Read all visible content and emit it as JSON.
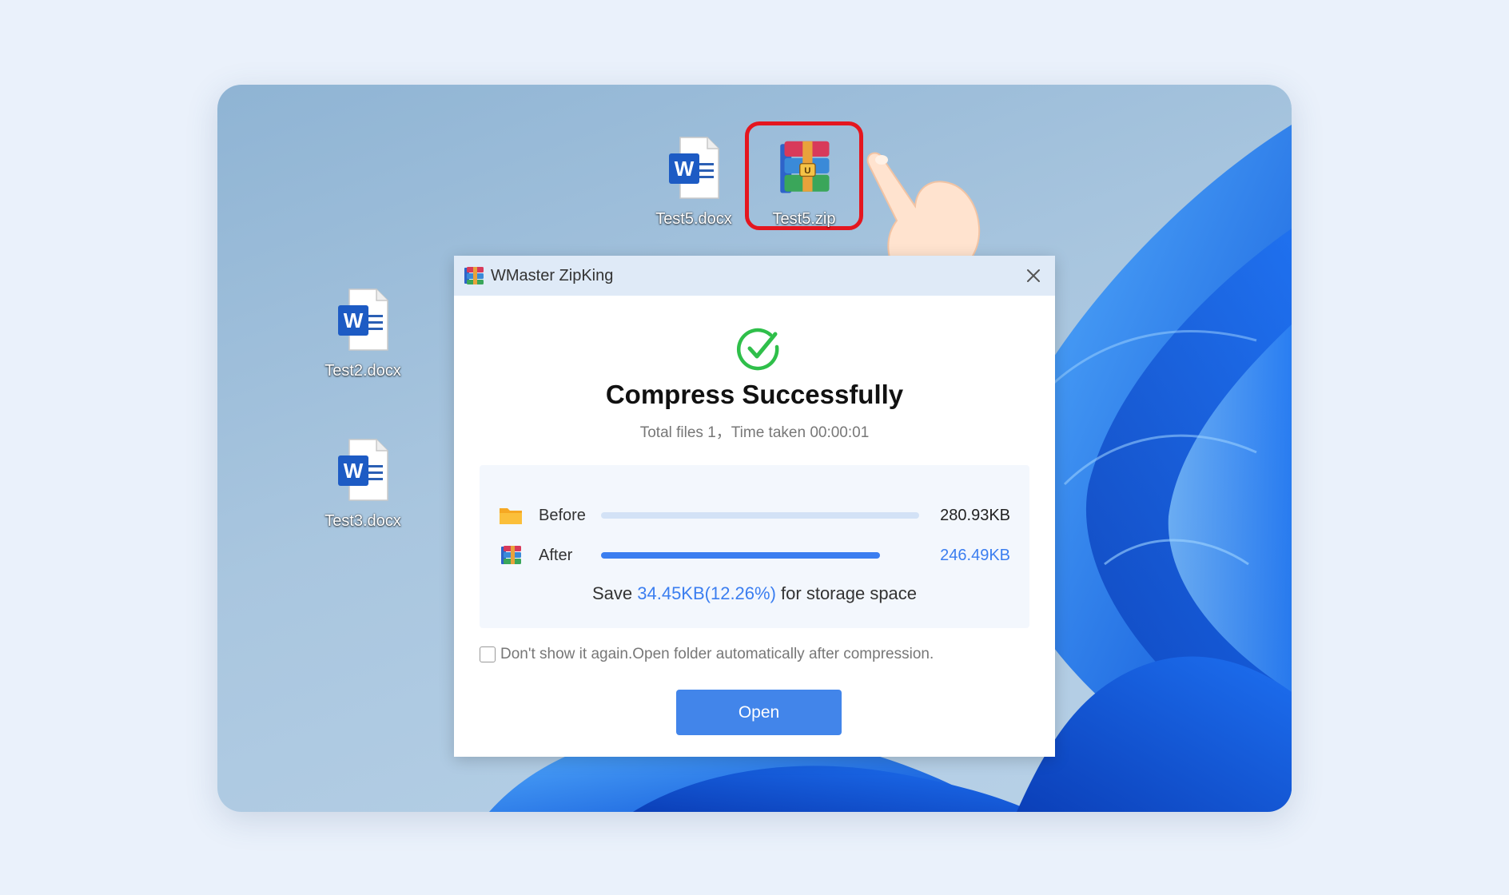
{
  "desktop": {
    "icons": [
      {
        "label": "Test5.docx",
        "icon": "word-doc-icon"
      },
      {
        "label": "Test5.zip",
        "icon": "zip-archive-icon"
      },
      {
        "label": "Test2.docx",
        "icon": "word-doc-icon"
      },
      {
        "label": "Test3.docx",
        "icon": "word-doc-icon"
      }
    ]
  },
  "dialog": {
    "title": "WMaster ZipKing",
    "headline": "Compress Successfully",
    "summary": "Total files 1，Time taken 00:00:01",
    "before": {
      "label": "Before",
      "value": "280.93KB",
      "fill_fraction": 1.0
    },
    "after": {
      "label": "After",
      "value": "246.49KB",
      "fill_fraction": 0.877
    },
    "save": {
      "prefix": "Save",
      "amount": "34.45KB(12.26%)",
      "suffix": "for storage space"
    },
    "checkbox_label": "Don't show it again.Open folder automatically after compression.",
    "checkbox_checked": false,
    "open_button": "Open"
  },
  "colors": {
    "accent": "#4285ea",
    "success": "#2fbf4a",
    "highlight": "#e4161f",
    "bar_before": "#d3e2f6",
    "bar_after": "#3b7ef0"
  }
}
